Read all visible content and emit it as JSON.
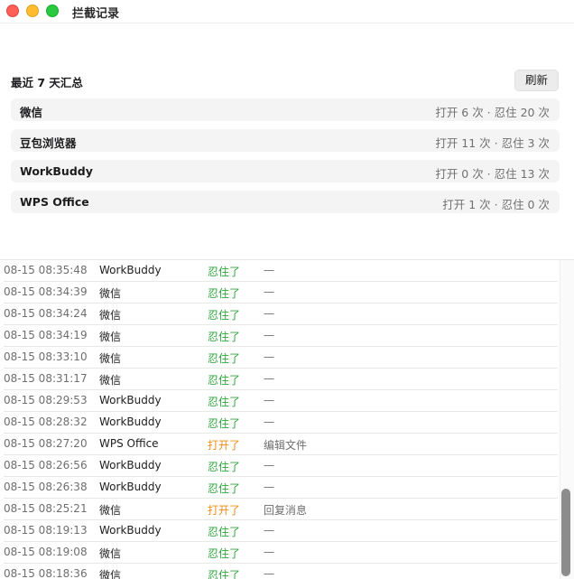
{
  "window": {
    "title": "拦截记录"
  },
  "summary": {
    "title": "最近 7 天汇总",
    "refresh_label": "刷新",
    "apps": [
      {
        "name": "微信",
        "stats": "打开 6 次 · 忍住 20 次"
      },
      {
        "name": "豆包浏览器",
        "stats": "打开 11 次 · 忍住 3 次"
      },
      {
        "name": "WorkBuddy",
        "stats": "打开 0 次 · 忍住 13 次"
      },
      {
        "name": "WPS Office",
        "stats": "打开 1 次 · 忍住 0 次"
      }
    ]
  },
  "log": [
    {
      "time": "08-15 08:35:48",
      "app": "WorkBuddy",
      "status": "忍住了",
      "status_type": "resist",
      "note": "—"
    },
    {
      "time": "08-15 08:34:39",
      "app": "微信",
      "status": "忍住了",
      "status_type": "resist",
      "note": "—"
    },
    {
      "time": "08-15 08:34:24",
      "app": "微信",
      "status": "忍住了",
      "status_type": "resist",
      "note": "—"
    },
    {
      "time": "08-15 08:34:19",
      "app": "微信",
      "status": "忍住了",
      "status_type": "resist",
      "note": "—"
    },
    {
      "time": "08-15 08:33:10",
      "app": "微信",
      "status": "忍住了",
      "status_type": "resist",
      "note": "—"
    },
    {
      "time": "08-15 08:31:17",
      "app": "微信",
      "status": "忍住了",
      "status_type": "resist",
      "note": "—"
    },
    {
      "time": "08-15 08:29:53",
      "app": "WorkBuddy",
      "status": "忍住了",
      "status_type": "resist",
      "note": "—"
    },
    {
      "time": "08-15 08:28:32",
      "app": "WorkBuddy",
      "status": "忍住了",
      "status_type": "resist",
      "note": "—"
    },
    {
      "time": "08-15 08:27:20",
      "app": "WPS Office",
      "status": "打开了",
      "status_type": "open",
      "note": "编辑文件"
    },
    {
      "time": "08-15 08:26:56",
      "app": "WorkBuddy",
      "status": "忍住了",
      "status_type": "resist",
      "note": "—"
    },
    {
      "time": "08-15 08:26:38",
      "app": "WorkBuddy",
      "status": "忍住了",
      "status_type": "resist",
      "note": "—"
    },
    {
      "time": "08-15 08:25:21",
      "app": "微信",
      "status": "打开了",
      "status_type": "open",
      "note": "回复消息"
    },
    {
      "time": "08-15 08:19:13",
      "app": "WorkBuddy",
      "status": "忍住了",
      "status_type": "resist",
      "note": "—"
    },
    {
      "time": "08-15 08:19:08",
      "app": "微信",
      "status": "忍住了",
      "status_type": "resist",
      "note": "—"
    },
    {
      "time": "08-15 08:18:36",
      "app": "微信",
      "status": "忍住了",
      "status_type": "resist",
      "note": "—"
    }
  ],
  "colors": {
    "resist": "#2ea43a",
    "open": "#f08a16",
    "close_button": "#fe5f57",
    "minimize_button": "#febc2e",
    "zoom_button": "#28c840"
  },
  "icons": {
    "close": "close-icon",
    "minimize": "minimize-icon",
    "zoom": "zoom-icon"
  }
}
